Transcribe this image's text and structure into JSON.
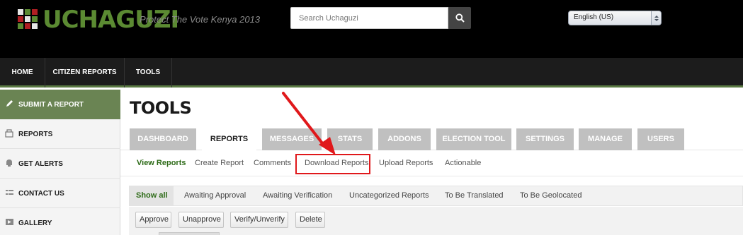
{
  "header": {
    "logo_text": "UCHAGUZI",
    "tagline": "Protect The Vote Kenya 2013",
    "search": {
      "placeholder": "Search Uchaguzi"
    },
    "language": {
      "selected": "English (US)"
    }
  },
  "main_nav": {
    "items": [
      {
        "label": "HOME"
      },
      {
        "label": "CITIZEN REPORTS"
      },
      {
        "label": "TOOLS"
      }
    ]
  },
  "sidebar": {
    "items": [
      {
        "label": "SUBMIT A REPORT",
        "icon": "pencil-icon",
        "active": true
      },
      {
        "label": "REPORTS",
        "icon": "reports-icon"
      },
      {
        "label": "GET ALERTS",
        "icon": "alerts-icon"
      },
      {
        "label": "CONTACT US",
        "icon": "contact-icon"
      },
      {
        "label": "GALLERY",
        "icon": "gallery-icon"
      }
    ]
  },
  "page": {
    "title": "TOOLS"
  },
  "tabs": [
    {
      "label": "DASHBOARD"
    },
    {
      "label": "REPORTS",
      "active": true
    },
    {
      "label": "MESSAGES"
    },
    {
      "label": "STATS"
    },
    {
      "label": "ADDONS"
    },
    {
      "label": "ELECTION TOOL"
    },
    {
      "label": "SETTINGS"
    },
    {
      "label": "MANAGE"
    },
    {
      "label": "USERS"
    }
  ],
  "subtabs": [
    {
      "label": "View Reports",
      "active": true
    },
    {
      "label": "Create Report"
    },
    {
      "label": "Comments"
    },
    {
      "label": "Download Reports",
      "highlighted": true
    },
    {
      "label": "Upload Reports"
    },
    {
      "label": "Actionable"
    }
  ],
  "filters": [
    {
      "label": "Show all",
      "active": true
    },
    {
      "label": "Awaiting Approval"
    },
    {
      "label": "Awaiting Verification"
    },
    {
      "label": "Uncategorized Reports"
    },
    {
      "label": "To Be Translated"
    },
    {
      "label": "To Be Geolocated"
    }
  ],
  "actions": [
    {
      "label": "Approve"
    },
    {
      "label": "Unapprove"
    },
    {
      "label": "Verify/Unverify"
    },
    {
      "label": "Delete"
    }
  ],
  "colors": {
    "brand_green": "#5b8a32",
    "active_green": "#2e6b18",
    "highlight_red": "#e0181b",
    "sidebar_active": "#6a8453"
  }
}
